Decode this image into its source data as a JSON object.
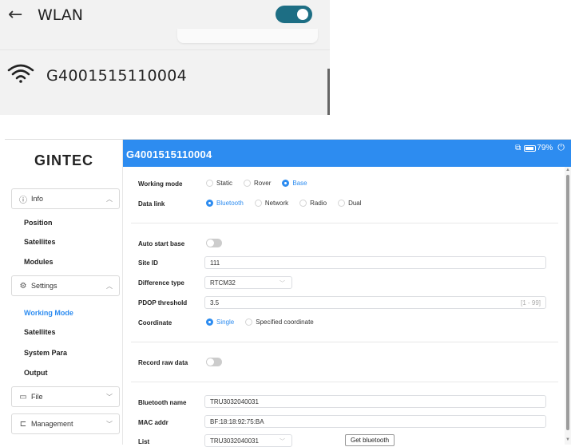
{
  "phone": {
    "back_icon": "←",
    "title": "WLAN",
    "toggle_on": true,
    "network_name": "G4001515110004"
  },
  "app": {
    "logo": "GINTEC",
    "header_title": "G4001515110004",
    "battery_text": "79%",
    "sidebar": {
      "info_label": "Info",
      "info_items": [
        "Position",
        "Satellites",
        "Modules"
      ],
      "settings_label": "Settings",
      "settings_items": [
        "Working Mode",
        "Satellites",
        "System Para",
        "Output"
      ],
      "file_label": "File",
      "management_label": "Management"
    },
    "form": {
      "working_mode_label": "Working mode",
      "working_mode_options": [
        "Static",
        "Rover",
        "Base"
      ],
      "working_mode_selected": "Base",
      "data_link_label": "Data link",
      "data_link_options": [
        "Bluetooth",
        "Network",
        "Radio",
        "Dual"
      ],
      "data_link_selected": "Bluetooth",
      "auto_start_label": "Auto start base",
      "auto_start_on": false,
      "site_id_label": "Site ID",
      "site_id_value": "111",
      "diff_type_label": "Difference type",
      "diff_type_value": "RTCM32",
      "pdop_label": "PDOP threshold",
      "pdop_value": "3.5",
      "pdop_range": "[1 - 99]",
      "coordinate_label": "Coordinate",
      "coordinate_options": [
        "Single",
        "Specified coordinate"
      ],
      "coordinate_selected": "Single",
      "record_raw_label": "Record raw data",
      "record_raw_on": false,
      "bt_name_label": "Bluetooth name",
      "bt_name_value": "TRU3032040031",
      "mac_label": "MAC addr",
      "mac_value": "BF:18:18:92:75:BA",
      "list_label": "List",
      "list_value": "TRU3032040031",
      "get_bt_button": "Get bluetooth"
    }
  },
  "colors": {
    "accent": "#2d8cf0",
    "toggle_phone": "#1d6e84"
  },
  "icons": {
    "info": "info-circle-icon",
    "settings": "gear-icon",
    "file": "folder-icon",
    "management": "management-icon",
    "wifi": "wifi-icon",
    "power": "power-icon",
    "screen_mirror": "screen-mirror-icon"
  }
}
